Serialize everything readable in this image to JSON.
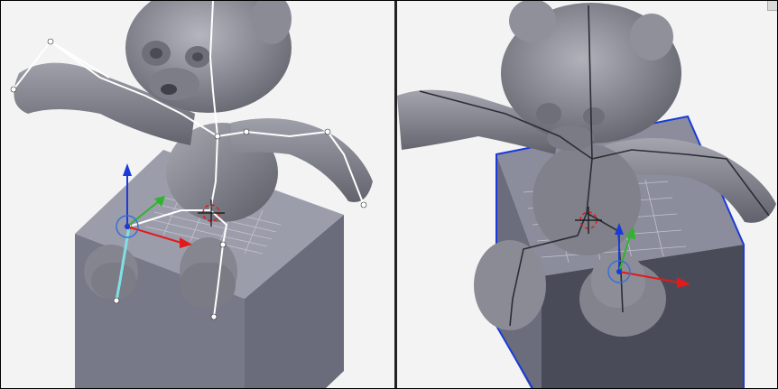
{
  "app": {
    "name": "3d-modeling-viewport-split"
  },
  "viewports": [
    {
      "id": "left",
      "view": "rigged-bear-front-3quarter"
    },
    {
      "id": "right",
      "view": "rigged-bear-rear-3quarter"
    }
  ],
  "colors": {
    "background": "#f3f3f3",
    "mesh_light": "#8e8f96",
    "mesh_dark": "#4f5059",
    "box_top": "#9c9dab",
    "box_side": "#6f7080",
    "box_dark": "#4a4b58",
    "bone": "#ffffff",
    "bone_selected": "#7fe0e6",
    "axis_x": "#e31a1a",
    "axis_y": "#2db52d",
    "axis_z": "#1a3ad9",
    "selection_outline": "#1a3ad9",
    "grid": "#c8c8d2"
  },
  "icons": [
    "transform-gizmo-icon",
    "3d-cursor-icon",
    "corner-split-widget-icon"
  ]
}
